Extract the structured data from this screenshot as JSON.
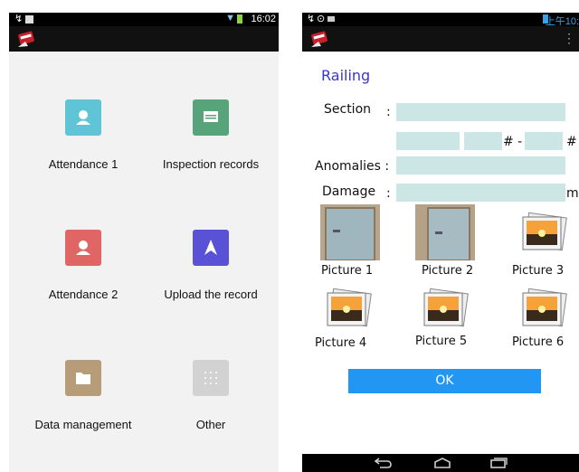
{
  "left": {
    "status_time": "16:02",
    "tiles": [
      {
        "label": "Attendance 1",
        "color": "#5ec4d6",
        "icon": "person-icon"
      },
      {
        "label": "Inspection records",
        "color": "#58a47a",
        "icon": "message-icon"
      },
      {
        "label": "Attendance 2",
        "color": "#e06565",
        "icon": "person-icon"
      },
      {
        "label": "Upload the record",
        "color": "#5a52d6",
        "icon": "arrow-up-icon"
      },
      {
        "label": "Data management",
        "color": "#b79c79",
        "icon": "folder-icon"
      },
      {
        "label": "Other",
        "color": "#d2d2d2",
        "icon": "grid-icon"
      }
    ]
  },
  "right": {
    "status_time": "上午10:",
    "title": "Railing",
    "section_label": "Section",
    "hash_separator": "# -",
    "hash_end": "#",
    "anomalies_label": "Anomalies :",
    "damage_label": "Damage",
    "damage_unit": "m",
    "colon": ":",
    "pictures": [
      "Picture 1",
      "Picture 2",
      "Picture 3",
      "Picture 4",
      "Picture 5",
      "Picture 6"
    ],
    "ok_label": "OK",
    "accent": "#2196f3",
    "field_color": "#cbe6e4"
  }
}
